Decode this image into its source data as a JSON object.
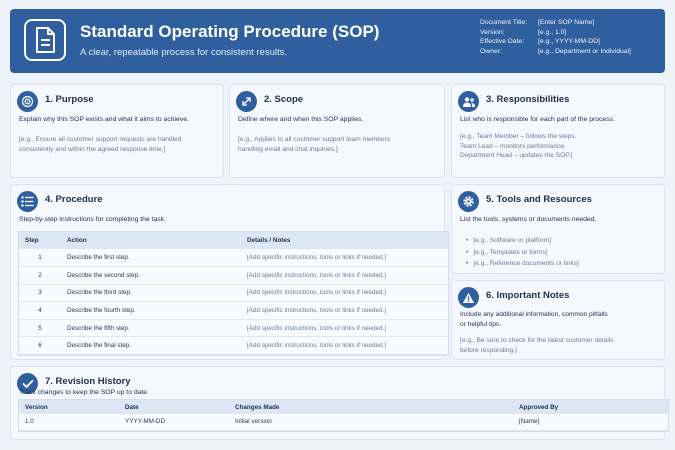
{
  "header": {
    "title": "Standard Operating Procedure (SOP)",
    "subtitle": "A clear, repeatable process for consistent results.",
    "meta": [
      {
        "label": "Document Title:",
        "value": "[Enter SOP Name]"
      },
      {
        "label": "Version:",
        "value": "[e.g., 1.0]"
      },
      {
        "label": "Effective Date:",
        "value": "[e.g., YYYY-MM-DD]"
      },
      {
        "label": "Owner:",
        "value": "[e.g., Department or Individual]"
      }
    ]
  },
  "purpose": {
    "title": "1. Purpose",
    "desc": "Explain why this SOP exists and what it aims to achieve.",
    "example": [
      "[e.g., Ensure all customer support requests are handled",
      "consistently and within the agreed response time.]"
    ]
  },
  "scope": {
    "title": "2. Scope",
    "desc": "Define where and when this SOP applies.",
    "example": [
      "[e.g., Applies to all customer support team members",
      "handling email and chat inquiries.]"
    ]
  },
  "responsibilities": {
    "title": "3. Responsibilities",
    "desc": "List who is responsible for each part of the process.",
    "example": [
      "[e.g., Team Member – follows the steps.",
      "Team Lead – monitors performance.",
      "Department Head – updates the SOP.]"
    ]
  },
  "procedure": {
    "title": "4. Procedure",
    "desc": "Step-by-step instructions for completing the task.",
    "columns": [
      "Step",
      "Action",
      "Details / Notes"
    ],
    "rows": [
      {
        "step": "1",
        "action": "Describe the first step.",
        "details": "[Add specific instructions, tools or links if needed.]"
      },
      {
        "step": "2",
        "action": "Describe the second step.",
        "details": "[Add specific instructions, tools or links if needed.]"
      },
      {
        "step": "3",
        "action": "Describe the third step.",
        "details": "[Add specific instructions, tools or links if needed.]"
      },
      {
        "step": "4",
        "action": "Describe the fourth step.",
        "details": "[Add specific instructions, tools or links if needed.]"
      },
      {
        "step": "5",
        "action": "Describe the fifth step.",
        "details": "[Add specific instructions, tools or links if needed.]"
      },
      {
        "step": "6",
        "action": "Describe the final step.",
        "details": "[Add specific instructions, tools or links if needed.]"
      }
    ]
  },
  "tools": {
    "title": "5. Tools and Resources",
    "desc": "List the tools, systems or documents needed.",
    "items": [
      "[e.g., Software or platform]",
      "[e.g., Templates or forms]",
      "[e.g., Reference documents or links]"
    ]
  },
  "notes": {
    "title": "6. Important Notes",
    "desc": [
      "Include any additional information, common pitfalls",
      "or helpful tips."
    ],
    "example": [
      "[e.g., Be sure to check for the latest customer details",
      "before responding.]"
    ]
  },
  "revision": {
    "title": "7. Revision History",
    "desc": "Track changes to keep the SOP up to date.",
    "columns": [
      "Version",
      "Date",
      "Changes Made",
      "Approved By"
    ],
    "rows": [
      {
        "version": "1.0",
        "date": "YYYY-MM-DD",
        "changes": "Initial version",
        "approved": "[Name]"
      }
    ]
  },
  "colors": {
    "primary": "#2f5f9e",
    "background": "#eef3fa",
    "card": "#f5f8fd",
    "hint": "#6b7c96"
  }
}
